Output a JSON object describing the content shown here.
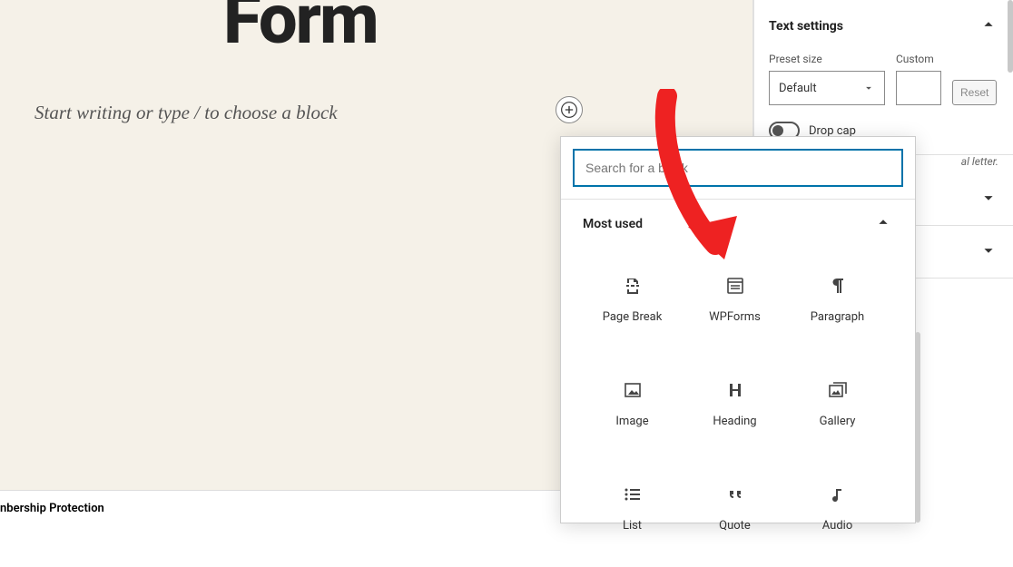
{
  "editor": {
    "title_fragment": "Form",
    "placeholder": "Start writing or type / to choose a block"
  },
  "block_picker": {
    "search_placeholder": "Search for a block",
    "section_title": "Most used",
    "blocks": [
      {
        "icon": "page-break-icon",
        "label": "Page Break"
      },
      {
        "icon": "wpforms-icon",
        "label": "WPForms"
      },
      {
        "icon": "paragraph-icon",
        "label": "Paragraph"
      },
      {
        "icon": "image-icon",
        "label": "Image"
      },
      {
        "icon": "heading-icon",
        "label": "Heading"
      },
      {
        "icon": "gallery-icon",
        "label": "Gallery"
      },
      {
        "icon": "list-icon",
        "label": "List"
      },
      {
        "icon": "quote-icon",
        "label": "Quote"
      },
      {
        "icon": "audio-icon",
        "label": "Audio"
      }
    ]
  },
  "metabox": {
    "title": "nbership Protection"
  },
  "sidebar": {
    "panel_title": "Text settings",
    "preset_label": "Preset size",
    "preset_value": "Default",
    "custom_label": "Custom",
    "reset_label": "Reset",
    "dropcap_label": "Drop cap",
    "hint_fragment": "al letter."
  }
}
